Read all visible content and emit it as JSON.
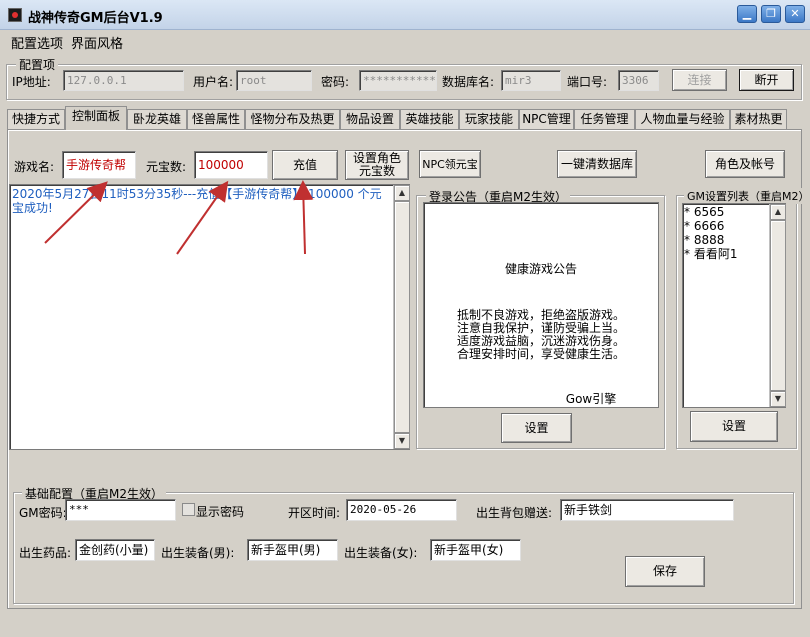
{
  "window": {
    "title": "战神传奇GM后台V1.9",
    "controls": {
      "minimize": "▁",
      "restore": "❐",
      "close": "✕"
    }
  },
  "menu": [
    "配置选项",
    "界面风格"
  ],
  "config_group": {
    "title": "配置项",
    "ip_label": "IP地址:",
    "ip_value": "127.0.0.1",
    "user_label": "用户名:",
    "user_value": "root",
    "password_label": "密码:",
    "password_value": "************",
    "db_label": "数据库名:",
    "db_value": "mir3",
    "port_label": "端口号:",
    "port_value": "3306",
    "connect_button": "连接",
    "disconnect_button": "断开"
  },
  "tabs": [
    "快捷方式",
    "控制面板",
    "卧龙英雄",
    "怪兽属性",
    "怪物分布及热更",
    "物品设置",
    "英雄技能",
    "玩家技能",
    "NPC管理",
    "任务管理",
    "人物血量与经验",
    "素材热更"
  ],
  "control_panel": {
    "game_name_label": "游戏名:",
    "game_name_value": "手游传奇帮",
    "ingot_label": "元宝数:",
    "ingot_value": "100000",
    "recharge_button": "充值",
    "set_role_ingot_button": "设置角色元宝数",
    "npc_ingot_button": "NPC领元宝",
    "clear_db_button": "一键清数据库",
    "role_account_button": "角色及帐号",
    "log_text": "2020年5月27日11时53分35秒---充值【手游传奇帮】 100000 个元宝成功!"
  },
  "login_notice": {
    "title": "登录公告（重启M2生效）",
    "heading": "健康游戏公告",
    "lines": [
      "抵制不良游戏，拒绝盗版游戏。",
      "注意自我保护，谨防受骗上当。",
      "适度游戏益脑，沉迷游戏伤身。",
      "合理安排时间，享受健康生活。"
    ],
    "footer": "Gow引擎",
    "set_button": "设置"
  },
  "gm_list": {
    "title": "GM设置列表（重启M2）",
    "items": [
      "* 6565",
      "* 6666",
      "* 8888",
      "* 看看阿1"
    ],
    "set_button": "设置"
  },
  "base_config": {
    "title": "基础配置（重启M2生效）",
    "gm_password_label": "GM密码:",
    "gm_password_value": "***",
    "show_password_label": "显示密码",
    "open_time_label": "开区时间:",
    "open_time_value": "2020-05-26",
    "bag_gift_label": "出生背包赠送:",
    "bag_gift_value": "新手铁剑",
    "medicine_label": "出生药品:",
    "medicine_value": "金创药(小量)",
    "equip_male_label": "出生装备(男):",
    "equip_male_value": "新手盔甲(男)",
    "equip_female_label": "出生装备(女):",
    "equip_female_value": "新手盔甲(女)",
    "save_button": "保存"
  },
  "colors": {
    "accent_text": "#c00000",
    "log_text": "#1f5fbf",
    "annotation_arrow": "#c03030"
  }
}
